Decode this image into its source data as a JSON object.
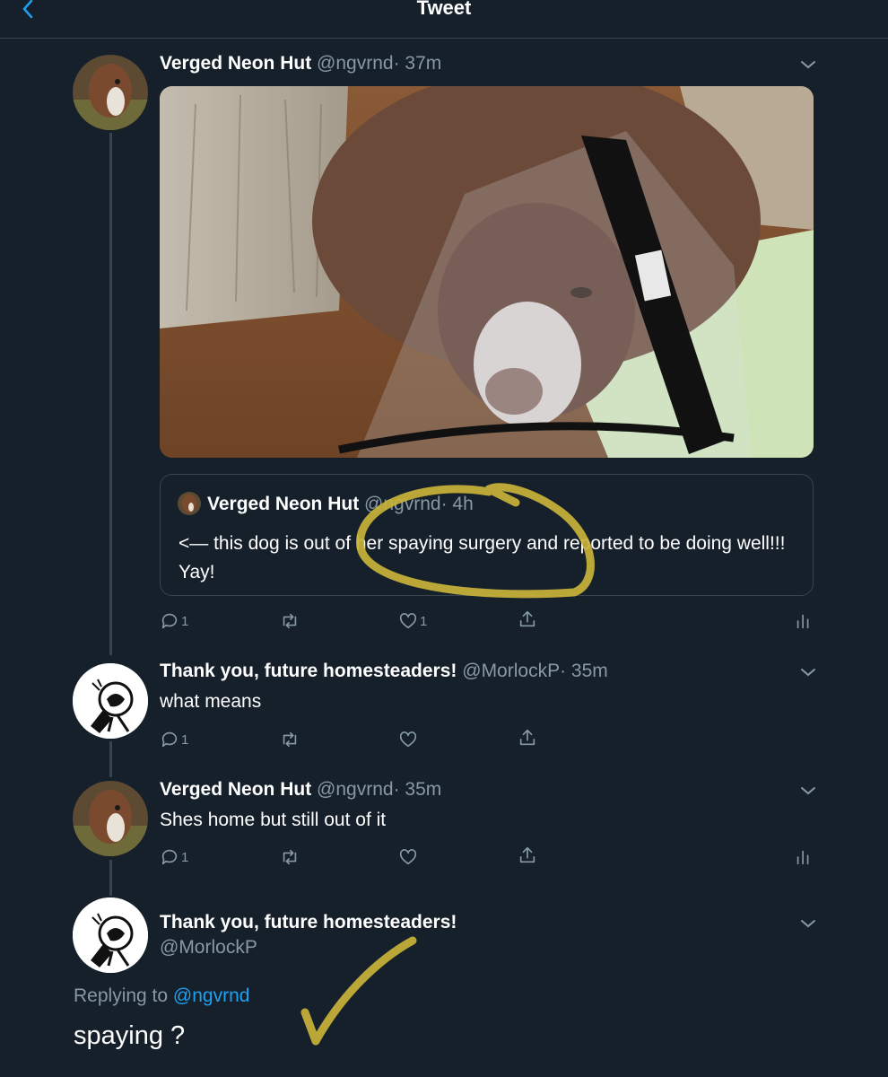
{
  "header": {
    "title": "Tweet"
  },
  "tweet1": {
    "name": "Verged Neon Hut",
    "handle": "@ngvrnd",
    "time": "· 37m",
    "quote": {
      "name": "Verged Neon Hut",
      "handle": "@ngvrnd",
      "time": "· 4h",
      "text": "<— this dog is out of her spaying surgery and reported to be doing well!!!  Yay!"
    },
    "replies": "1",
    "likes": "1"
  },
  "tweet2": {
    "name": "Thank you, future homesteaders!",
    "handle": "@MorlockP",
    "time": "· 35m",
    "text": "what means",
    "replies": "1"
  },
  "tweet3": {
    "name": "Verged Neon Hut",
    "handle": "@ngvrnd",
    "time": "· 35m",
    "text": "Shes home but still out of it",
    "replies": "1"
  },
  "main": {
    "name": "Thank you, future homesteaders!",
    "handle": "@MorlockP",
    "replying_prefix": "Replying to ",
    "replying_to": "@ngvrnd",
    "text": "spaying ?"
  },
  "colors": {
    "background": "#15202b",
    "muted": "#8899a6",
    "link": "#1da1f2",
    "annotation": "#c9b33a"
  },
  "icons": [
    "back-icon",
    "chevron-down-icon",
    "reply-icon",
    "retweet-icon",
    "like-icon",
    "share-icon",
    "analytics-icon"
  ]
}
